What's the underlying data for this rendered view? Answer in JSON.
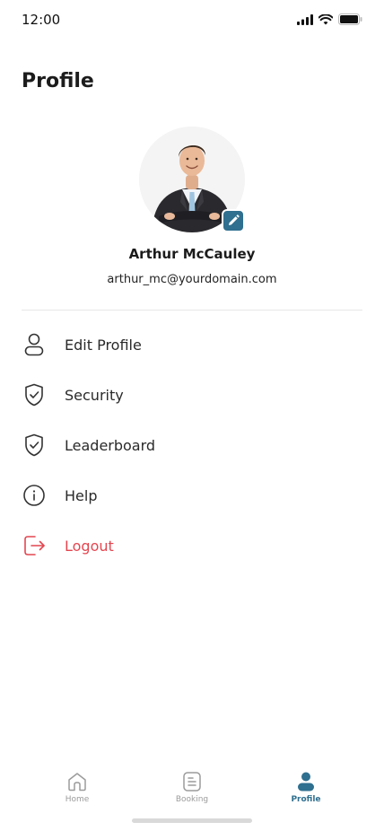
{
  "status_bar": {
    "time": "12:00",
    "icons": [
      "signal-icon",
      "wifi-icon",
      "battery-icon"
    ]
  },
  "header": {
    "title": "Profile"
  },
  "profile": {
    "name": "Arthur McCauley",
    "email": "arthur_mc@yourdomain.com",
    "edit_icon": "pencil-icon"
  },
  "menu": {
    "items": [
      {
        "label": "Edit Profile",
        "icon": "user-icon"
      },
      {
        "label": "Security",
        "icon": "shield-check-icon"
      },
      {
        "label": "Leaderboard",
        "icon": "shield-check-icon"
      },
      {
        "label": "Help",
        "icon": "info-icon"
      },
      {
        "label": "Logout",
        "icon": "logout-icon"
      }
    ]
  },
  "tabbar": {
    "tabs": [
      {
        "label": "Home",
        "icon": "home-icon"
      },
      {
        "label": "Booking",
        "icon": "document-icon"
      },
      {
        "label": "Profile",
        "icon": "user-filled-icon",
        "active": true
      }
    ]
  },
  "colors": {
    "accent": "#2f6f8f",
    "danger": "#e44650",
    "text": "#222222",
    "muted": "#9b9b9b"
  }
}
